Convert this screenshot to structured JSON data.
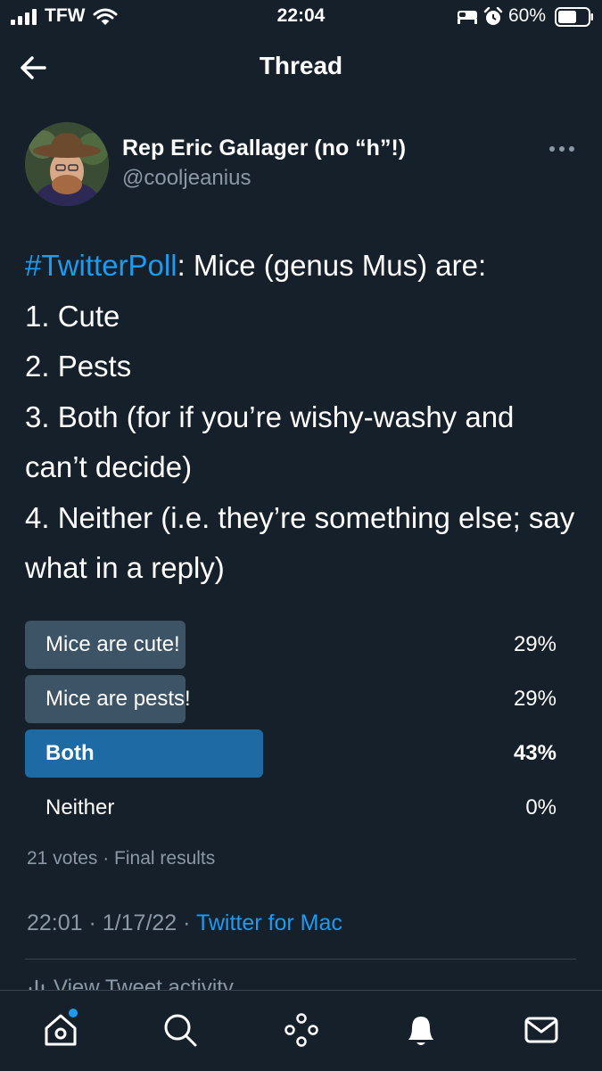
{
  "status_bar": {
    "carrier": "TFW",
    "time": "22:04",
    "battery": "60%"
  },
  "header": {
    "title": "Thread"
  },
  "tweet": {
    "author_name": "Rep Eric Gallager (no “h”!)",
    "author_handle": "@cooljeanius",
    "hashtag": "#TwitterPoll",
    "text": ": Mice (genus Mus) are:\n1. Cute\n2. Pests\n3. Both (for if you’re wishy-washy and can’t decide)\n4. Neither (i.e. they’re something else; say what in a reply)",
    "poll": {
      "options": [
        {
          "label": "Mice are cute!",
          "percent_text": "29%",
          "fraction": 0.29,
          "leading": false
        },
        {
          "label": "Mice are pests!",
          "percent_text": "29%",
          "fraction": 0.29,
          "leading": false
        },
        {
          "label": "Both",
          "percent_text": "43%",
          "fraction": 0.43,
          "leading": true
        },
        {
          "label": "Neither",
          "percent_text": "0%",
          "fraction": 0.0,
          "leading": false
        }
      ],
      "summary": "21 votes · Final results"
    },
    "time": "22:01",
    "date": "1/17/22",
    "source": "Twitter for Mac",
    "activity_label": "View Tweet activity"
  },
  "icons": {
    "back": "arrow-left-icon",
    "more": "more-horizontal-icon",
    "tabs": [
      "home-icon",
      "search-icon",
      "spaces-icon",
      "notifications-icon",
      "messages-icon"
    ]
  },
  "colors": {
    "background": "#15202b",
    "accent": "#1d9bf0",
    "poll_bar": "#3d5466",
    "poll_bar_leading": "#1d6aa4",
    "secondary_text": "#8b98a5"
  }
}
